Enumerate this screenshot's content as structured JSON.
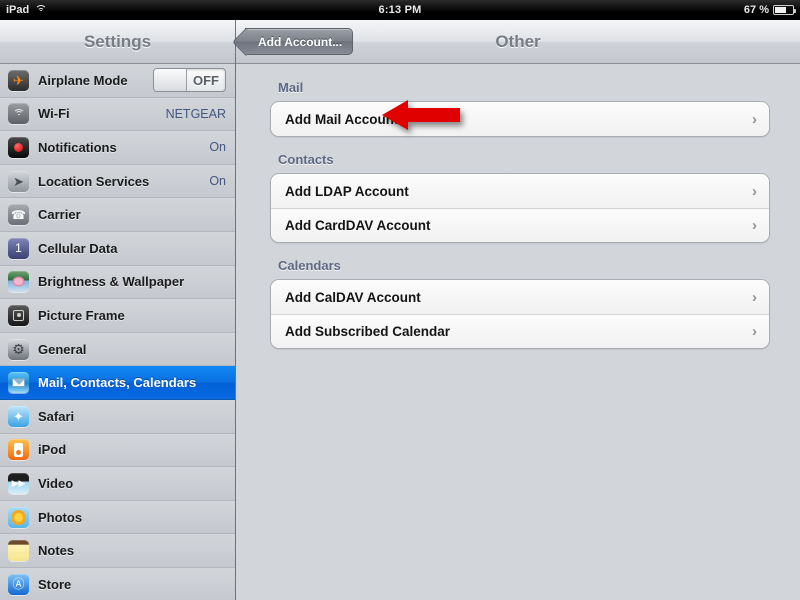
{
  "statusbar": {
    "device_label": "iPad",
    "wifi_icon": "wifi-icon",
    "time": "6:13 PM",
    "battery_percent": "67 %",
    "battery_level": 67
  },
  "sidebar": {
    "title": "Settings",
    "items": [
      {
        "label": "Airplane Mode",
        "value": "",
        "icon": "airplane-icon",
        "control": "toggle",
        "toggle_label": "OFF",
        "selected": false
      },
      {
        "label": "Wi-Fi",
        "value": "NETGEAR",
        "icon": "wifi-icon",
        "selected": false
      },
      {
        "label": "Notifications",
        "value": "On",
        "icon": "notifications-icon",
        "selected": false
      },
      {
        "label": "Location Services",
        "value": "On",
        "icon": "location-icon",
        "selected": false
      },
      {
        "label": "Carrier",
        "value": "",
        "icon": "carrier-phone-icon",
        "selected": false
      },
      {
        "label": "Cellular Data",
        "value": "",
        "icon": "cellular-antenna-icon",
        "selected": false
      },
      {
        "label": "Brightness & Wallpaper",
        "value": "",
        "icon": "brightness-wallpaper-icon",
        "selected": false
      },
      {
        "label": "Picture Frame",
        "value": "",
        "icon": "picture-frame-icon",
        "selected": false
      },
      {
        "label": "General",
        "value": "",
        "icon": "gear-icon",
        "selected": false
      },
      {
        "label": "Mail, Contacts, Calendars",
        "value": "",
        "icon": "mail-envelope-icon",
        "selected": true
      },
      {
        "label": "Safari",
        "value": "",
        "icon": "safari-compass-icon",
        "selected": false
      },
      {
        "label": "iPod",
        "value": "",
        "icon": "ipod-icon",
        "selected": false
      },
      {
        "label": "Video",
        "value": "",
        "icon": "video-clapperboard-icon",
        "selected": false
      },
      {
        "label": "Photos",
        "value": "",
        "icon": "photos-sunflower-icon",
        "selected": false
      },
      {
        "label": "Notes",
        "value": "",
        "icon": "notes-pad-icon",
        "selected": false
      },
      {
        "label": "Store",
        "value": "",
        "icon": "app-store-icon",
        "selected": false
      }
    ]
  },
  "navbar": {
    "back_label": "Add Account...",
    "back_icon": "chevron-left-icon",
    "title": "Other"
  },
  "main": {
    "sections": [
      {
        "header": "Mail",
        "rows": [
          {
            "label": "Add Mail Account",
            "disclosure": "chevron-right-icon",
            "annotated": true
          }
        ]
      },
      {
        "header": "Contacts",
        "rows": [
          {
            "label": "Add LDAP Account",
            "disclosure": "chevron-right-icon"
          },
          {
            "label": "Add CardDAV Account",
            "disclosure": "chevron-right-icon"
          }
        ]
      },
      {
        "header": "Calendars",
        "rows": [
          {
            "label": "Add CalDAV Account",
            "disclosure": "chevron-right-icon"
          },
          {
            "label": "Add Subscribed Calendar",
            "disclosure": "chevron-right-icon"
          }
        ]
      }
    ],
    "annotation": {
      "type": "arrow-left",
      "color": "#e00000",
      "points_to": "Add Mail Account"
    }
  },
  "colors": {
    "selection_blue": "#0a6fe0",
    "value_text": "#42567f",
    "group_header": "#5d6a84",
    "annotation_red": "#e00000"
  }
}
